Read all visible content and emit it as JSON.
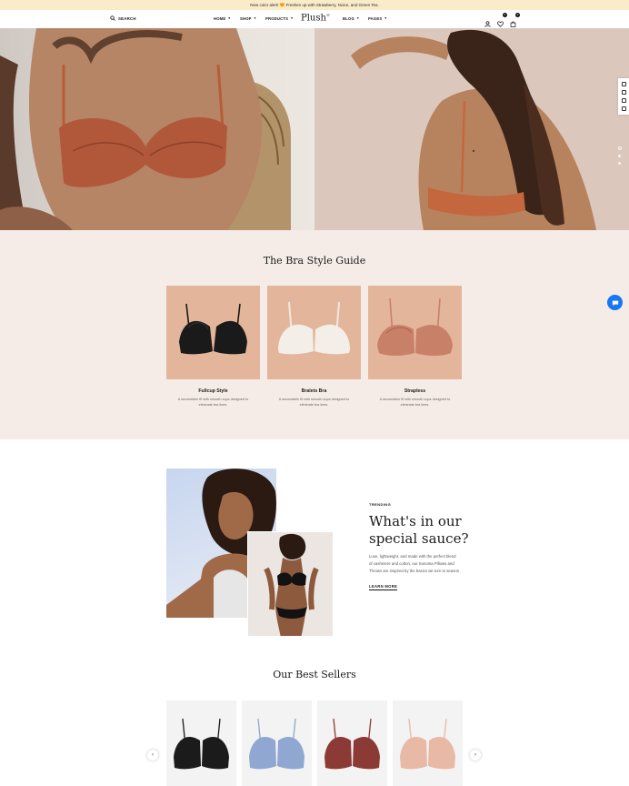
{
  "announcement": {
    "text": "New color alert! 🧡 Freshen up with Strawberry, Noice, and Green Tea."
  },
  "header": {
    "search_label": "SEARCH",
    "nav": [
      {
        "label": "HOME"
      },
      {
        "label": "SHOP"
      },
      {
        "label": "PRODUCTS"
      },
      {
        "label": "BLOG"
      },
      {
        "label": "PAGES"
      }
    ],
    "logo": "Plush",
    "logo_mark": "®",
    "wishlist_count": "0",
    "cart_count": "0"
  },
  "hero": {
    "slides_count": 3,
    "active_slide": 1
  },
  "guide": {
    "title": "The Bra Style Guide",
    "cards": [
      {
        "name": "Fullcup Style",
        "desc": "A secondskin fit with smooth cups designed to eliminate bra lines.",
        "color": "#1a1a1a"
      },
      {
        "name": "Bralets Bra",
        "desc": "A secondskin fit with smooth cups designed to eliminate bra lines.",
        "color": "#f1ece4"
      },
      {
        "name": "Strapless",
        "desc": "A secondskin fit with smooth cups designed to eliminate bra lines.",
        "color": "#c98068"
      }
    ]
  },
  "trending": {
    "eyebrow": "TRENDING",
    "title": "What's in our special sauce?",
    "body": "Luxe, lightweight, and made with the perfect blend of cashmere and cotton, our Sonoma Pillows and Throws are inspired by the basics we turn to season",
    "cta": "LEARN MORE"
  },
  "best_sellers": {
    "title": "Our Best Sellers",
    "products": [
      {
        "color": "#1b1b1b"
      },
      {
        "color": "#8fa7d1"
      },
      {
        "color": "#8c3a35"
      },
      {
        "color": "#e8b9a5"
      }
    ]
  },
  "colors": {
    "accent": "#1877f2",
    "announce_bg": "#fbecc9",
    "guide_bg": "#f5ece7"
  }
}
